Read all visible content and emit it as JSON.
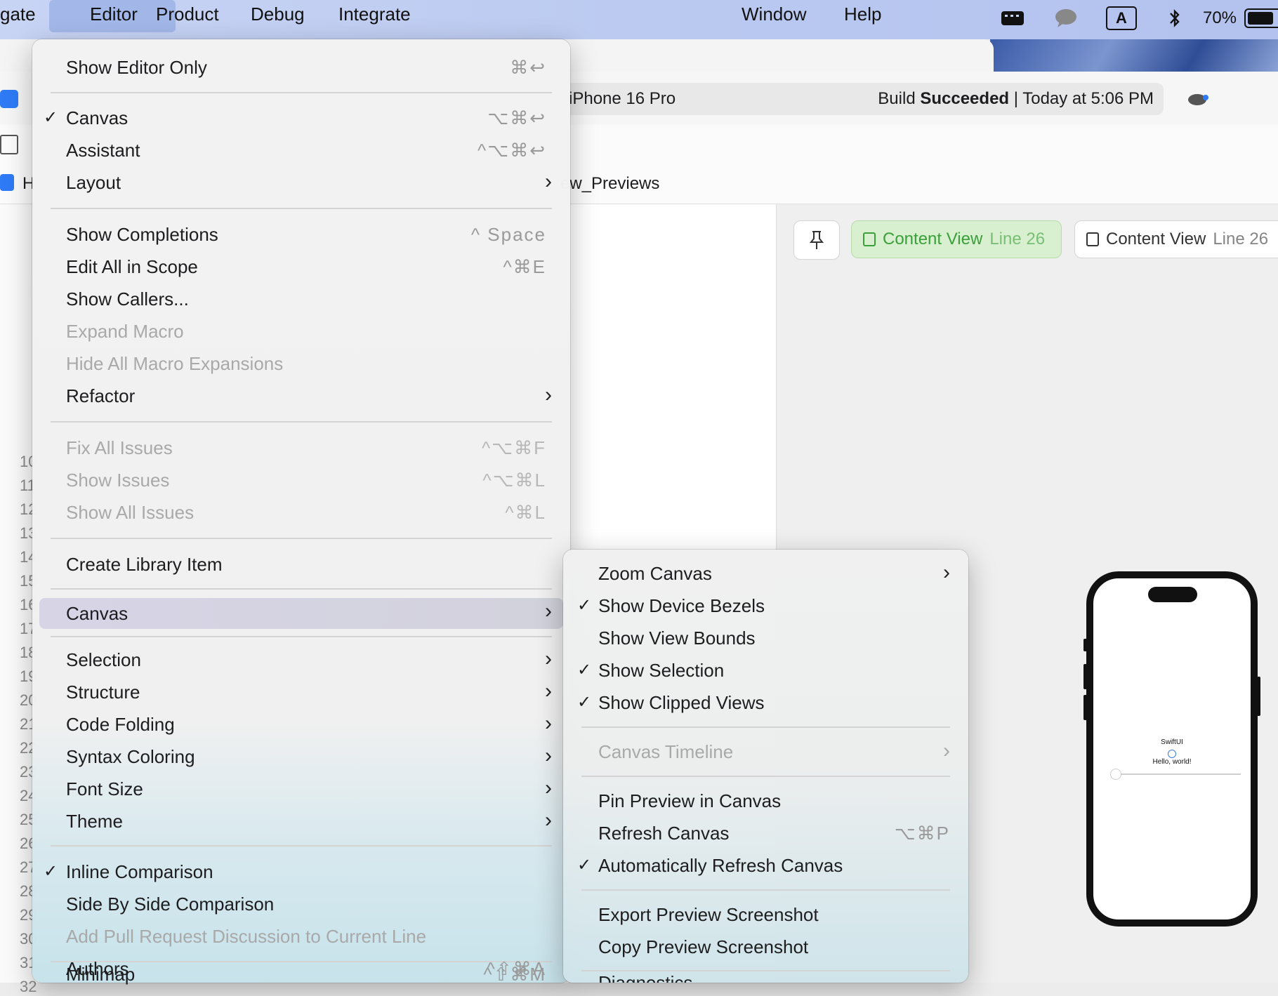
{
  "menubar": {
    "items": [
      "gate",
      "Editor",
      "Product",
      "Debug",
      "Integrate",
      "Window",
      "Help"
    ],
    "battery": "70%",
    "input_source": "A"
  },
  "toolbar": {
    "device": "iPhone 16 Pro",
    "build_prefix": "Build ",
    "build_status": "Succeeded",
    "build_time": " | Today at 5:06 PM"
  },
  "jumpbar": {
    "crumb": "ew_Previews",
    "left_label": "H"
  },
  "gutter": {
    "lines": [
      "10",
      "11",
      "12",
      "13",
      "14",
      "15",
      "16",
      "17",
      "18",
      "19",
      "20",
      "21",
      "22",
      "23",
      "24",
      "25",
      "26",
      "27",
      "28",
      "29",
      "30",
      "31",
      "32"
    ]
  },
  "canvas": {
    "tab_active": {
      "name": "Content View",
      "line": "Line 26"
    },
    "tab_other": {
      "name": "Content View",
      "line": "Line 26"
    },
    "phone": {
      "title": "SwiftUI",
      "greeting": "Hello, world!"
    }
  },
  "editor_menu": {
    "items": [
      {
        "label": "Show Editor Only",
        "shortcut": "⌘↩"
      },
      {
        "label": "Canvas",
        "shortcut": "⌥⌘↩",
        "checked": true
      },
      {
        "label": "Assistant",
        "shortcut": "^⌥⌘↩"
      },
      {
        "label": "Layout",
        "submenu": true
      },
      {
        "label": "Show Completions",
        "shortcut": "^ Space"
      },
      {
        "label": "Edit All in Scope",
        "shortcut": "^⌘E"
      },
      {
        "label": "Show Callers..."
      },
      {
        "label": "Expand Macro",
        "disabled": true
      },
      {
        "label": "Hide All Macro Expansions",
        "disabled": true
      },
      {
        "label": "Refactor",
        "submenu": true
      },
      {
        "label": "Fix All Issues",
        "shortcut": "^⌥⌘F",
        "disabled": true
      },
      {
        "label": "Show Issues",
        "shortcut": "^⌥⌘L",
        "disabled": true
      },
      {
        "label": "Show All Issues",
        "shortcut": "^⌘L",
        "disabled": true
      },
      {
        "label": "Create Library Item"
      },
      {
        "label": "Canvas",
        "submenu": true,
        "highlighted": true
      },
      {
        "label": "Selection",
        "submenu": true
      },
      {
        "label": "Structure",
        "submenu": true
      },
      {
        "label": "Code Folding",
        "submenu": true
      },
      {
        "label": "Syntax Coloring",
        "submenu": true
      },
      {
        "label": "Font Size",
        "submenu": true
      },
      {
        "label": "Theme",
        "submenu": true
      },
      {
        "label": "Inline Comparison",
        "checked": true
      },
      {
        "label": "Side By Side Comparison"
      },
      {
        "label": "Add Pull Request Discussion to Current Line",
        "disabled": true
      },
      {
        "label": "Minimap",
        "shortcut": "^⇧⌘M"
      },
      {
        "label": "Authors",
        "shortcut": "^⇧⌘A"
      }
    ]
  },
  "canvas_submenu": {
    "items": [
      {
        "label": "Zoom Canvas",
        "submenu": true
      },
      {
        "label": "Show Device Bezels",
        "checked": true
      },
      {
        "label": "Show View Bounds"
      },
      {
        "label": "Show Selection",
        "checked": true
      },
      {
        "label": "Show Clipped Views",
        "checked": true
      },
      {
        "label": "Canvas Timeline",
        "submenu": true,
        "disabled": true
      },
      {
        "label": "Pin Preview in Canvas"
      },
      {
        "label": "Refresh Canvas",
        "shortcut": "⌥⌘P"
      },
      {
        "label": "Automatically Refresh Canvas",
        "checked": true
      },
      {
        "label": "Export Preview Screenshot"
      },
      {
        "label": "Copy Preview Screenshot"
      },
      {
        "label": "Diagnostics"
      }
    ]
  },
  "symbols": {
    "check": "✓",
    "chevron": "›"
  }
}
